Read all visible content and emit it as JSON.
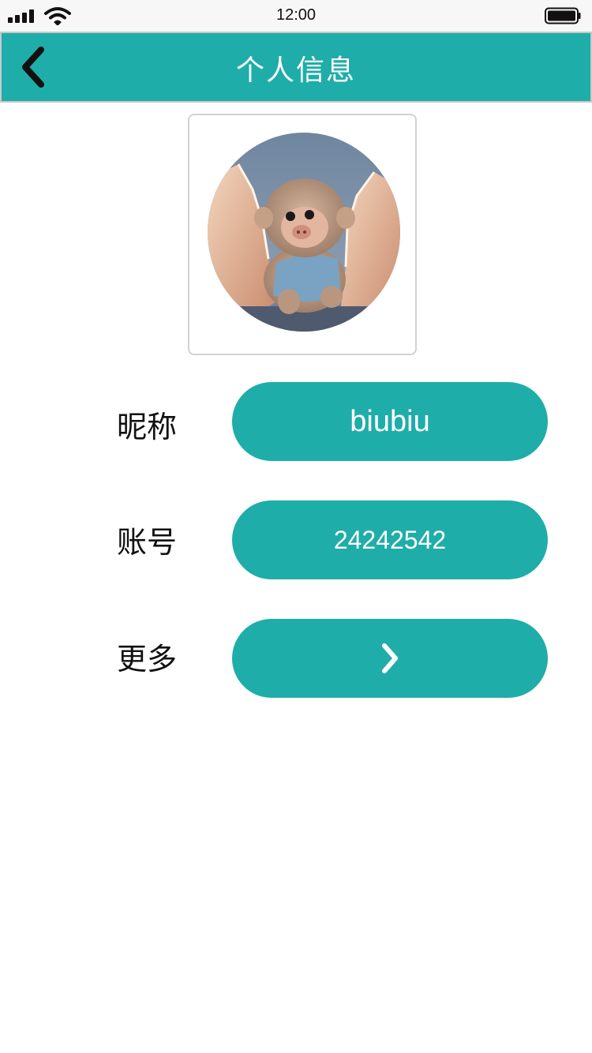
{
  "status_bar": {
    "time": "12:00",
    "signal_icon": "signal-bars-icon",
    "wifi_icon": "wifi-icon",
    "battery_icon": "battery-full-icon"
  },
  "nav": {
    "title": "个人信息",
    "back_icon": "chevron-left-icon"
  },
  "avatar": {
    "alt": "monkey-in-eggshell avatar"
  },
  "rows": [
    {
      "label": "昵称",
      "value": "biubiu"
    },
    {
      "label": "账号",
      "value": "24242542"
    },
    {
      "label": "更多",
      "value": "",
      "icon": "chevron-right-icon"
    }
  ],
  "colors": {
    "accent": "#1fada9",
    "status_bar_bg": "#f7f7f7",
    "text": "#111111",
    "pill_text": "#ffffff"
  }
}
